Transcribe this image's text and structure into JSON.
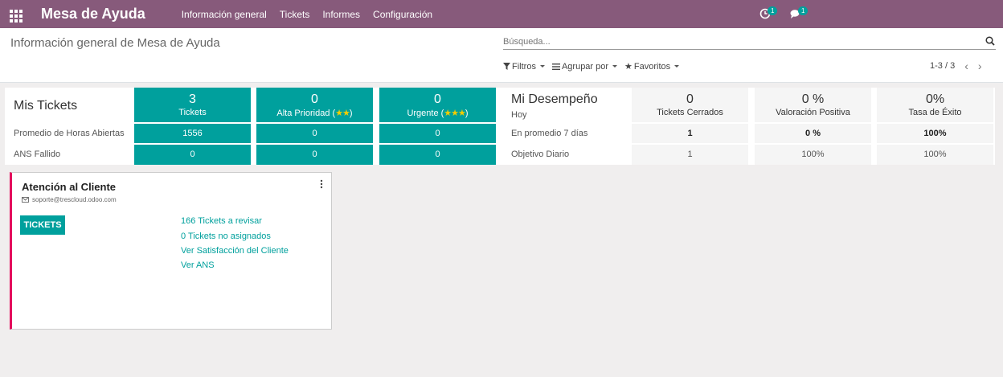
{
  "navbar": {
    "brand": "Mesa de Ayuda",
    "menu": [
      "Información general",
      "Tickets",
      "Informes",
      "Configuración"
    ],
    "activity_count": "1",
    "messages_count": "1"
  },
  "control_panel": {
    "title": "Información general de Mesa de Ayuda",
    "search_placeholder": "Búsqueda...",
    "filters_label": "Filtros",
    "group_by_label": "Agrupar por",
    "favorites_label": "Favoritos",
    "pager": "1-3 / 3"
  },
  "my_tickets": {
    "title": "Mis Tickets",
    "row_labels": [
      "Promedio de Horas Abiertas",
      "ANS Fallido"
    ],
    "tiles": [
      {
        "number": "3",
        "label": "Tickets",
        "avg_hours": "1556",
        "sla_failed": "0"
      },
      {
        "number": "0",
        "label": "Alta Prioridad (",
        "stars": "★★",
        "suffix": ")",
        "avg_hours": "0",
        "sla_failed": "0"
      },
      {
        "number": "0",
        "label": "Urgente (",
        "stars": "★★★",
        "suffix": ")",
        "avg_hours": "0",
        "sla_failed": "0"
      }
    ]
  },
  "performance": {
    "title": "Mi Desempeño",
    "row_labels": [
      "Hoy",
      "En promedio 7 días",
      "Objetivo Diario"
    ],
    "cols": [
      {
        "today": "0",
        "label": "Tickets Cerrados",
        "avg7": "1",
        "target": "1"
      },
      {
        "today": "0 %",
        "label": "Valoración Positiva",
        "avg7": "0 %",
        "target": "100%"
      },
      {
        "today": "0%",
        "label": "Tasa de Éxito",
        "avg7": "100%",
        "target": "100%"
      }
    ]
  },
  "team_card": {
    "name": "Atención al Cliente",
    "email": "soporte@trescloud.odoo.com",
    "button": "TICKETS",
    "links": [
      "166 Tickets a revisar",
      "0 Tickets no asignados",
      "Ver Satisfacción del Cliente",
      "Ver ANS"
    ]
  },
  "colors": {
    "navbar": "#875a7b",
    "accent": "#00a09d",
    "card_border": "#e40b5c"
  }
}
